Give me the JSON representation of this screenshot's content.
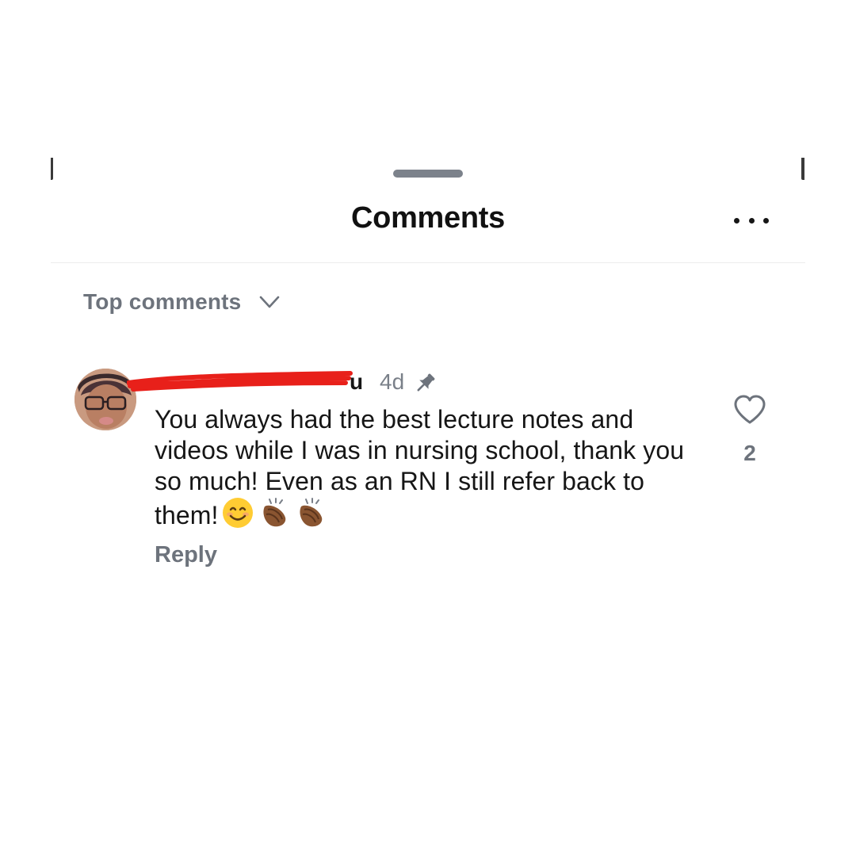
{
  "header": {
    "title": "Comments",
    "more_icon": "ellipsis-icon"
  },
  "sort": {
    "label": "Top comments",
    "icon": "chevron-down-icon"
  },
  "comment": {
    "username_visible": "u",
    "time": "4d",
    "pinned_icon": "pin-icon",
    "text": "You always had the best lecture notes and videos while I was in nursing school, thank you so much! Even as an RN I still refer back to them!",
    "emojis": [
      "smiling-face-emoji",
      "clapping-hands-emoji",
      "clapping-hands-emoji"
    ],
    "reply_label": "Reply",
    "like_count": "2",
    "like_icon": "heart-outline-icon"
  },
  "colors": {
    "text_primary": "#161616",
    "text_secondary": "#6d737c",
    "redaction": "#e8201a",
    "background": "#ffffff"
  }
}
